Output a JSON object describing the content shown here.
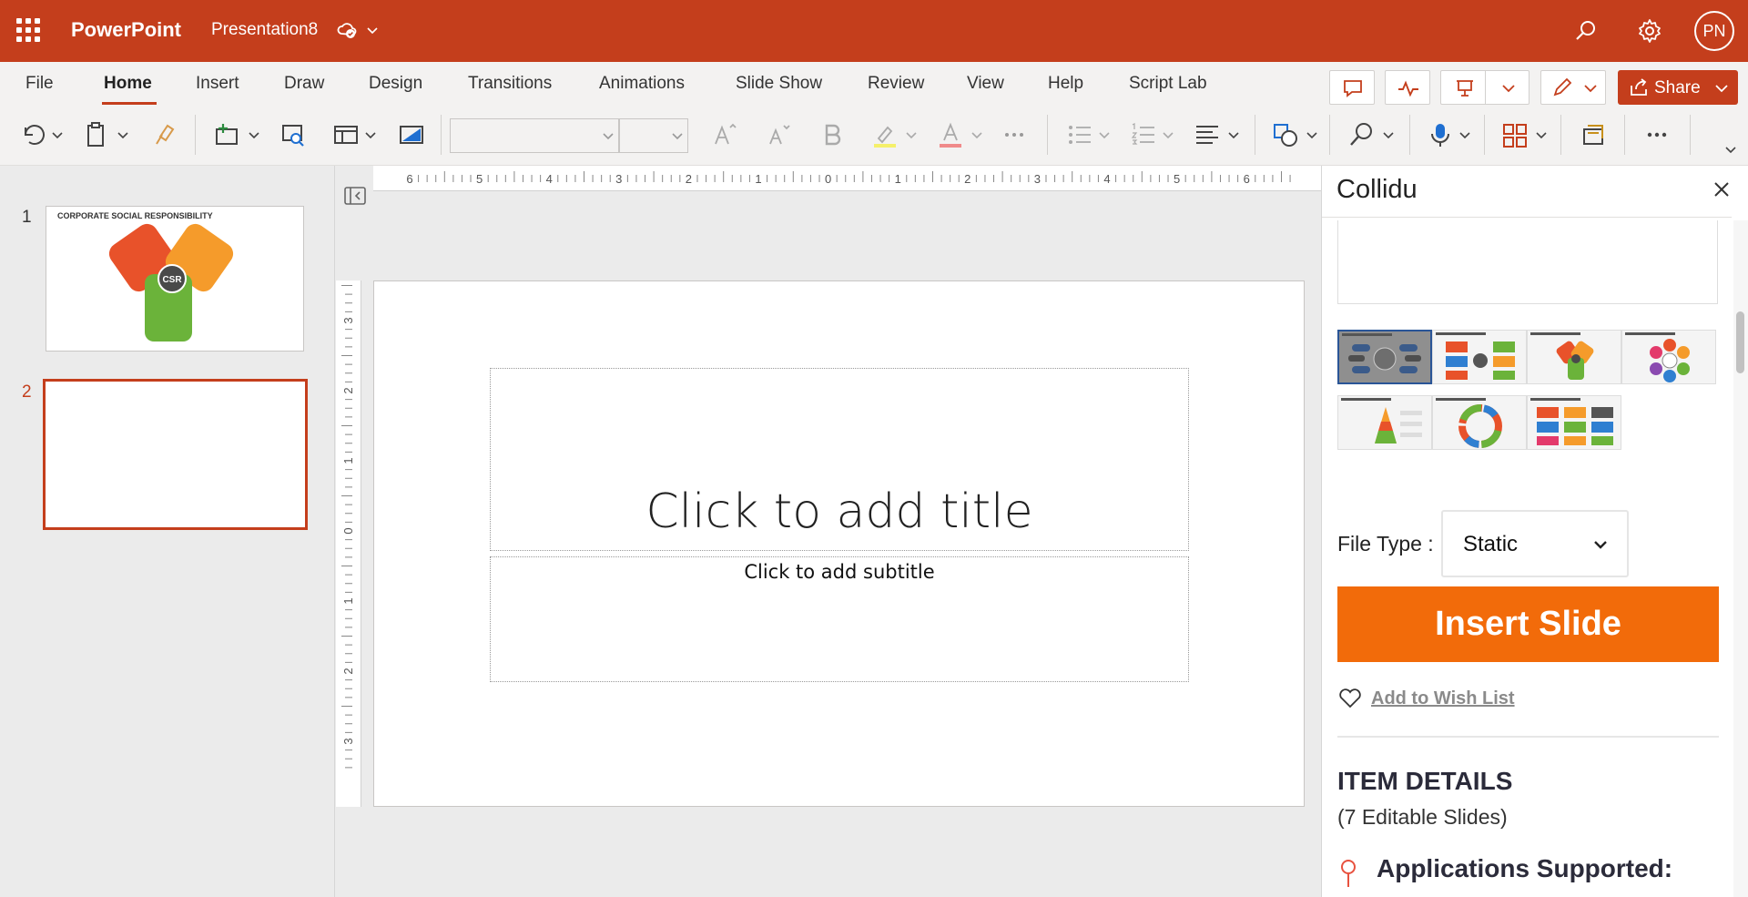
{
  "titlebar": {
    "app_name": "PowerPoint",
    "doc_name": "Presentation8",
    "avatar_initials": "PN"
  },
  "tabs": [
    "File",
    "Home",
    "Insert",
    "Draw",
    "Design",
    "Transitions",
    "Animations",
    "Slide Show",
    "Review",
    "View",
    "Help",
    "Script Lab"
  ],
  "active_tab": "Home",
  "share_label": "Share",
  "ruler": {
    "h_labels": [
      "6",
      "5",
      "4",
      "3",
      "2",
      "1",
      "0",
      "1",
      "2",
      "3",
      "4",
      "5",
      "6"
    ],
    "v_labels": [
      "3",
      "2",
      "1",
      "0",
      "1",
      "2",
      "3"
    ]
  },
  "thumbnails": {
    "items": [
      {
        "number": "1",
        "title": "CORPORATE SOCIAL RESPONSIBILITY",
        "center": "CSR"
      },
      {
        "number": "2"
      }
    ]
  },
  "slide": {
    "title_placeholder": "Click to add title",
    "subtitle_placeholder": "Click to add subtitle"
  },
  "pane": {
    "title": "Collidu",
    "file_type_label": "File Type :",
    "file_type_value": "Static",
    "insert_button": "Insert Slide",
    "wish_list": "Add to Wish List",
    "details_heading": "ITEM DETAILS",
    "details_sub": "(7 Editable Slides)",
    "apps_heading": "Applications Supported:"
  },
  "colors": {
    "brand": "#c43e1c",
    "insert_button": "#f26b0a",
    "selected_thumb": "#2a5597"
  }
}
